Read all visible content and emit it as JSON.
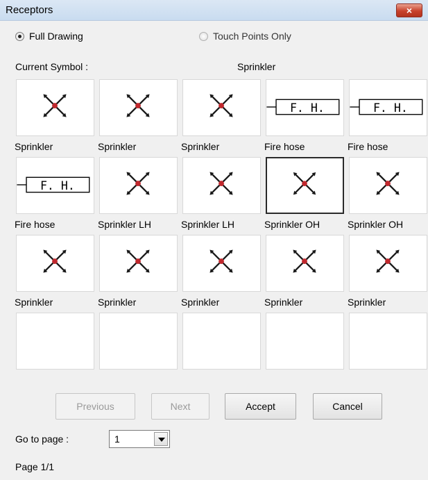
{
  "window": {
    "title": "Receptors",
    "close_label": "×"
  },
  "options": {
    "full_drawing": {
      "label": "Full Drawing",
      "selected": true
    },
    "touch_points_only": {
      "label": "Touch Points Only",
      "selected": false
    }
  },
  "current_symbol": {
    "label": "Current Symbol :",
    "value": "Sprinkler"
  },
  "symbols": [
    {
      "kind": "sprinkler",
      "label": "Sprinkler"
    },
    {
      "kind": "sprinkler",
      "label": "Sprinkler"
    },
    {
      "kind": "sprinkler",
      "label": "Sprinkler"
    },
    {
      "kind": "firehose",
      "label": "Fire hose",
      "glyph": "F. H."
    },
    {
      "kind": "firehose",
      "label": "Fire hose",
      "glyph": "F. H."
    },
    {
      "kind": "firehose",
      "label": "Fire hose",
      "glyph": "F. H."
    },
    {
      "kind": "sprinkler",
      "label": "Sprinkler LH"
    },
    {
      "kind": "sprinkler",
      "label": "Sprinkler LH"
    },
    {
      "kind": "sprinkler",
      "label": "Sprinkler OH",
      "selected": true
    },
    {
      "kind": "sprinkler",
      "label": "Sprinkler OH"
    },
    {
      "kind": "sprinkler",
      "label": "Sprinkler"
    },
    {
      "kind": "sprinkler",
      "label": "Sprinkler"
    },
    {
      "kind": "sprinkler",
      "label": "Sprinkler"
    },
    {
      "kind": "sprinkler",
      "label": "Sprinkler"
    },
    {
      "kind": "sprinkler",
      "label": "Sprinkler"
    },
    {
      "kind": "empty"
    },
    {
      "kind": "empty"
    },
    {
      "kind": "empty"
    },
    {
      "kind": "empty"
    },
    {
      "kind": "empty"
    }
  ],
  "buttons": {
    "previous": {
      "label": "Previous",
      "enabled": false
    },
    "next": {
      "label": "Next",
      "enabled": false
    },
    "accept": {
      "label": "Accept",
      "enabled": true
    },
    "cancel": {
      "label": "Cancel",
      "enabled": true
    }
  },
  "pagination": {
    "goto_label": "Go to page :",
    "page_value": "1",
    "status": "Page 1/1"
  },
  "colors": {
    "sprinkler_head": "#c0282d",
    "sprinkler_arm": "#1a1a1a"
  }
}
